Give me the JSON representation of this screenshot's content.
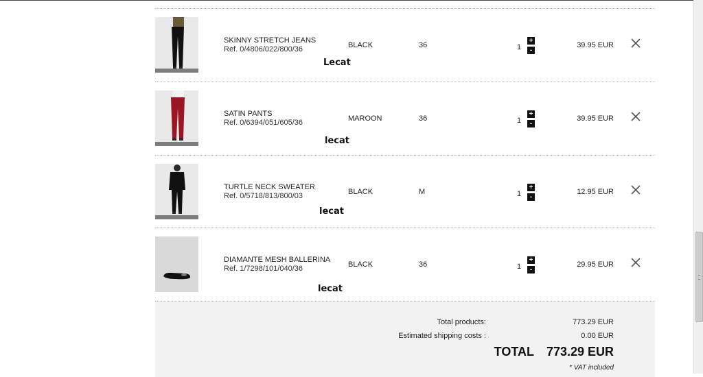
{
  "items": [
    {
      "name": "SKINNY STRETCH JEANS",
      "ref": "Ref. 0/4806/022/800/36",
      "note": "Lecat",
      "color": "BLACK",
      "size": "36",
      "qty": "1",
      "price": "39.95 EUR",
      "garment_color": "#111111"
    },
    {
      "name": "SATIN PANTS",
      "ref": "Ref. 0/6394/051/605/36",
      "note": "lecat",
      "color": "MAROON",
      "size": "36",
      "qty": "1",
      "price": "39.95 EUR",
      "garment_color": "#9b1624"
    },
    {
      "name": "TURTLE NECK SWEATER",
      "ref": "Ref. 0/5718/813/800/03",
      "note": "lecat",
      "color": "BLACK",
      "size": "M",
      "qty": "1",
      "price": "12.95 EUR",
      "garment_color": "#111111"
    },
    {
      "name": "DIAMANTE MESH BALLERINA",
      "ref": "Ref. 1/7298/101/040/36",
      "note": "lecat",
      "color": "BLACK",
      "size": "36",
      "qty": "1",
      "price": "29.95 EUR",
      "garment_color": "#111111"
    }
  ],
  "controls": {
    "plus": "+",
    "minus": "-"
  },
  "summary": {
    "total_products_label": "Total products:",
    "total_products_value": "773.29 EUR",
    "shipping_label": "Estimated shipping costs :",
    "shipping_value": "0.00 EUR",
    "total_label": "TOTAL",
    "total_value": "773.29 EUR",
    "vat_note": "* VAT included"
  },
  "icons": {
    "remove": "close-icon",
    "thumbnails": "product-image"
  }
}
